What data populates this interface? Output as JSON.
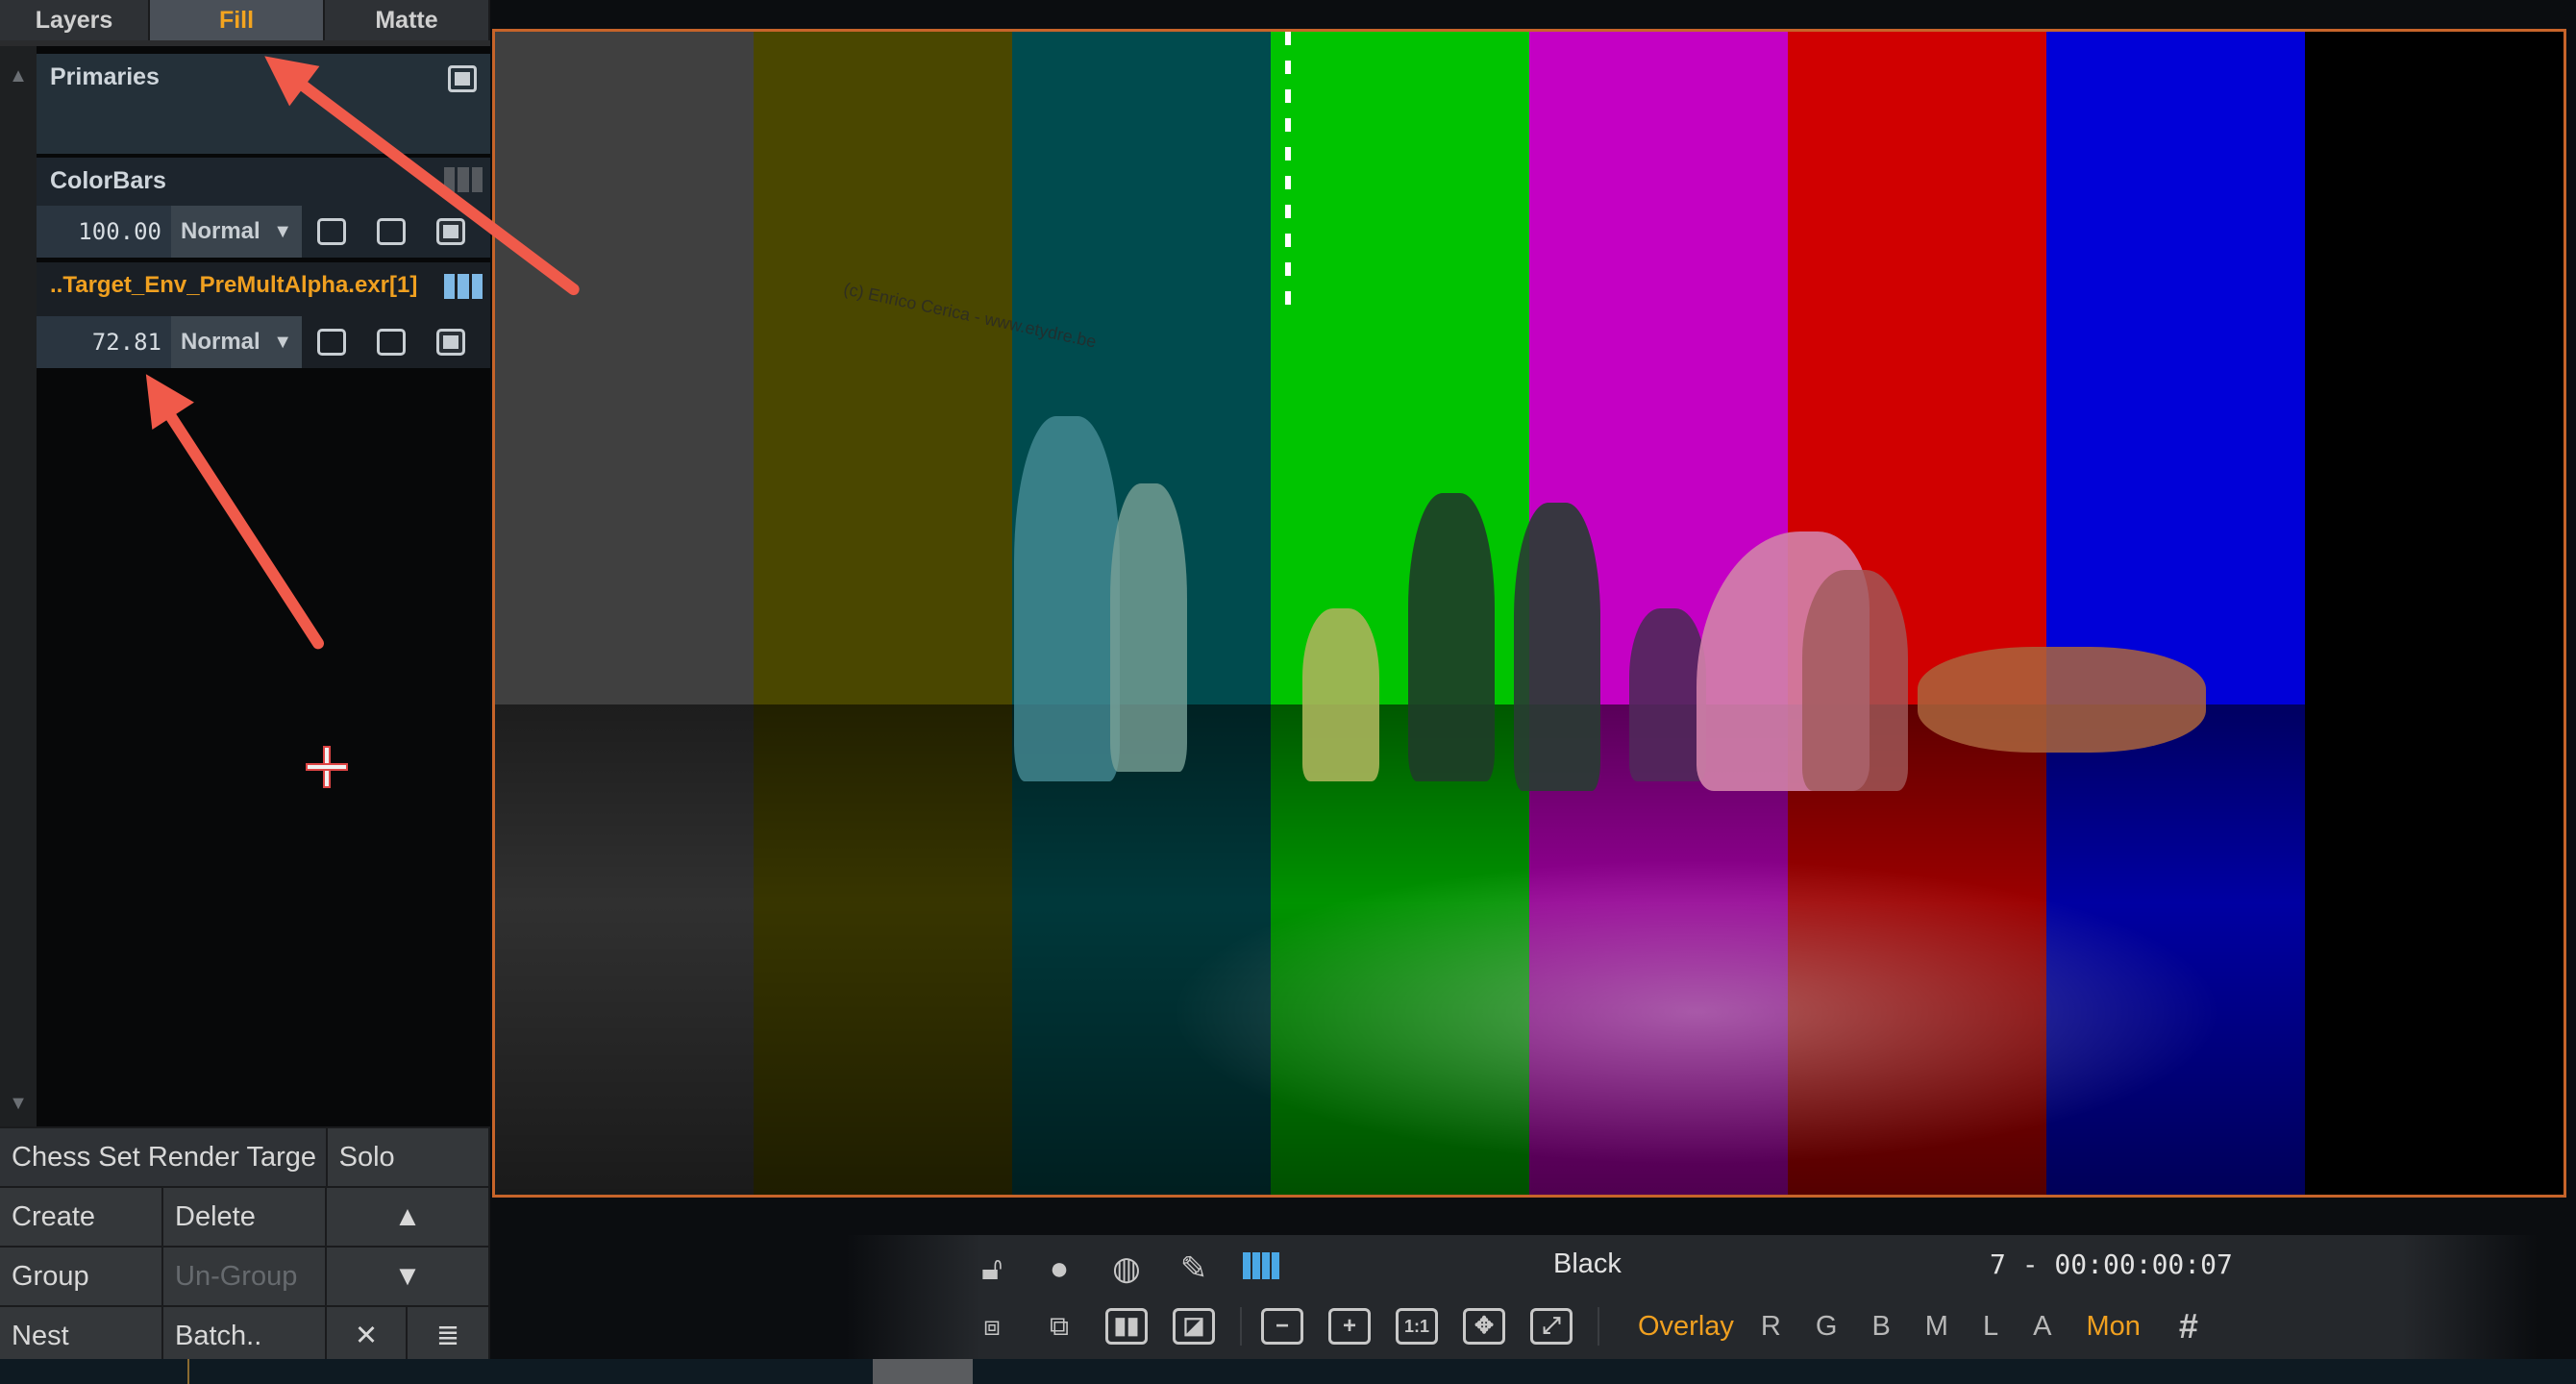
{
  "tabs": [
    {
      "label": "Layers"
    },
    {
      "label": "Fill"
    },
    {
      "label": "Matte"
    }
  ],
  "active_tab": "Fill",
  "layers": [
    {
      "name": "Primaries"
    },
    {
      "name": "ColorBars",
      "opacity": "100.00",
      "blend": "Normal"
    },
    {
      "name": "..Target_Env_PreMultAlpha.exr[1]",
      "opacity": "72.81",
      "blend": "Normal"
    }
  ],
  "group": {
    "name": "Chess Set Render Targe",
    "solo": "Solo"
  },
  "buttons": {
    "create": "Create",
    "delete": "Delete",
    "group": "Group",
    "ungroup": "Un-Group",
    "nest": "Nest",
    "batch": "Batch.."
  },
  "viewer": {
    "watermark": "(c) Enrico Cerica - www.etydre.be",
    "colorbar_colors": [
      "#404040",
      "#4a4700",
      "#004b4e",
      "#00c400",
      "#c400c4",
      "#d00000",
      "#0000d8",
      "#000000"
    ]
  },
  "toolbar": {
    "color_label": "Black",
    "timecode": "7  -  00:00:00:07",
    "overlay": "Overlay",
    "channels": [
      "R",
      "G",
      "B",
      "M",
      "L",
      "A"
    ],
    "monitor": "Mon",
    "zoom_1to1": "1:1"
  },
  "accent": {
    "orange": "#f0a020",
    "viewer_border": "#c7642a",
    "arrow": "#f05a4a"
  }
}
